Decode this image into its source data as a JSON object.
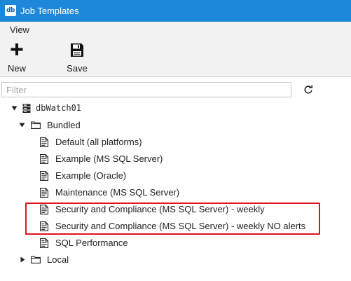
{
  "window": {
    "title": "Job Templates",
    "app_icon_text": "db"
  },
  "menu": {
    "items": [
      "View"
    ]
  },
  "toolbar": {
    "new_label": "New",
    "save_label": "Save"
  },
  "filter": {
    "placeholder": "Filter",
    "value": ""
  },
  "tree": {
    "root": {
      "label": "dbWatch01",
      "expanded": true
    },
    "bundled": {
      "label": "Bundled",
      "expanded": true,
      "items": [
        "Default (all platforms)",
        "Example (MS SQL Server)",
        "Example (Oracle)",
        "Maintenance (MS SQL Server)",
        "Security and Compliance (MS SQL Server) - weekly",
        "Security and Compliance (MS SQL Server) - weekly NO alerts",
        "SQL Performance"
      ]
    },
    "local": {
      "label": "Local",
      "expanded": false
    }
  },
  "annotation": {
    "highlight_color": "#e0141c",
    "highlighted_items": [
      4,
      5
    ]
  },
  "colors": {
    "titlebar": "#1e88d8",
    "menubar": "#f2f2f2"
  }
}
